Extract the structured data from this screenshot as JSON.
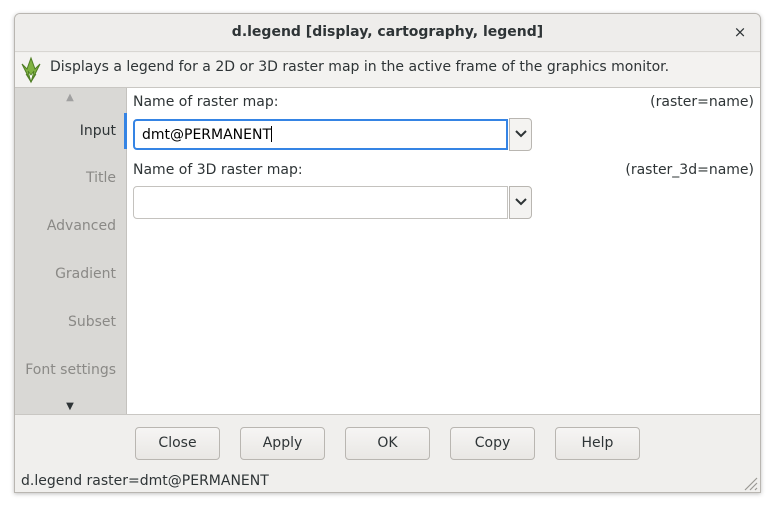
{
  "window": {
    "title": "d.legend [display, cartography, legend]",
    "close_glyph": "×"
  },
  "description": {
    "icon": "grass-logo-icon",
    "text": "Displays a legend for a 2D or 3D raster map in the active frame of the graphics monitor."
  },
  "tabs": {
    "scroll_up_glyph": "▲",
    "scroll_down_glyph": "▼",
    "items": [
      {
        "label": "Input",
        "active": true
      },
      {
        "label": "Title",
        "active": false
      },
      {
        "label": "Advanced",
        "active": false
      },
      {
        "label": "Gradient",
        "active": false
      },
      {
        "label": "Subset",
        "active": false
      },
      {
        "label": "Font settings",
        "active": false
      }
    ]
  },
  "fields": [
    {
      "label": "Name of raster map:",
      "key": "(raster=name)",
      "value": "dmt@PERMANENT",
      "focused": true
    },
    {
      "label": "Name of 3D raster map:",
      "key": "(raster_3d=name)",
      "value": "",
      "focused": false
    }
  ],
  "buttons": {
    "close": "Close",
    "apply": "Apply",
    "ok": "OK",
    "copy": "Copy",
    "help": "Help"
  },
  "status": {
    "command": "d.legend raster=dmt@PERMANENT"
  },
  "colors": {
    "accent": "#3584e4",
    "tab_bg": "#d9d8d5",
    "window_bg": "#f0efed"
  }
}
